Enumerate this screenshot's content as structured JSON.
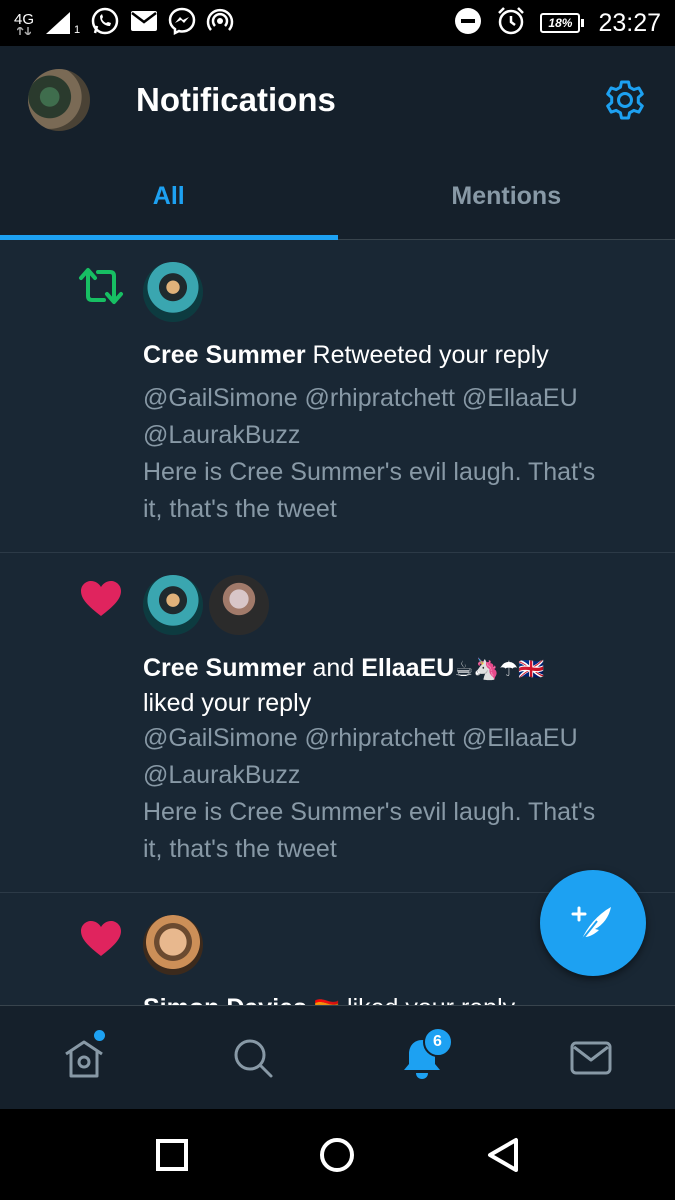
{
  "status_bar": {
    "network_label": "4G",
    "signal_sub": "1",
    "battery": "18%",
    "time": "23:27",
    "icons": [
      "network-4g-icon",
      "signal-icon",
      "whatsapp-icon",
      "mail-icon",
      "messenger-icon",
      "hotspot-icon",
      "do-not-disturb-icon",
      "alarm-icon",
      "battery-icon"
    ]
  },
  "header": {
    "title": "Notifications",
    "avatar_icon": "avatar",
    "settings_icon": "gear-icon"
  },
  "tabs": [
    {
      "label": "All",
      "active": true
    },
    {
      "label": "Mentions",
      "active": false
    }
  ],
  "notifications": [
    {
      "type": "retweet",
      "icon": "retweet-icon",
      "actor": "Cree Summer",
      "action": "Retweeted your reply",
      "mentions_line1": "@GailSimone @rhipratchett @EllaaEU",
      "mentions_line2": "@LaurakBuzz",
      "text_line1": "Here is Cree Summer's evil laugh. That's",
      "text_line2": "it, that's the tweet"
    },
    {
      "type": "like",
      "icon": "heart-icon",
      "actor": "Cree Summer",
      "joiner": "and",
      "actor2": "EllaaEU",
      "actor2_emoji": "☕🦄☂🇬🇧",
      "action": "liked your reply",
      "mentions_line1": "@GailSimone @rhipratchett @EllaaEU",
      "mentions_line2": "@LaurakBuzz",
      "text_line1": "Here is Cree Summer's evil laugh. That's",
      "text_line2": "it, that's the tweet"
    },
    {
      "type": "like",
      "icon": "heart-icon",
      "actor": "Simon Davies",
      "actor_emoji": "🏳️‍🌈",
      "action": "liked your reply"
    }
  ],
  "fab": {
    "icon": "compose-tweet-icon"
  },
  "bottom_nav": [
    {
      "name": "home",
      "icon": "home-icon",
      "has_dot": true
    },
    {
      "name": "search",
      "icon": "search-icon"
    },
    {
      "name": "notifications",
      "icon": "bell-icon",
      "badge": "6",
      "active": true
    },
    {
      "name": "messages",
      "icon": "mail-icon"
    }
  ],
  "colors": {
    "accent": "#1da1f2",
    "background": "#15202b",
    "feed_bg": "#192734",
    "secondary_text": "#8899a6",
    "retweet_green": "#17bf63",
    "like_red": "#e0245e"
  }
}
